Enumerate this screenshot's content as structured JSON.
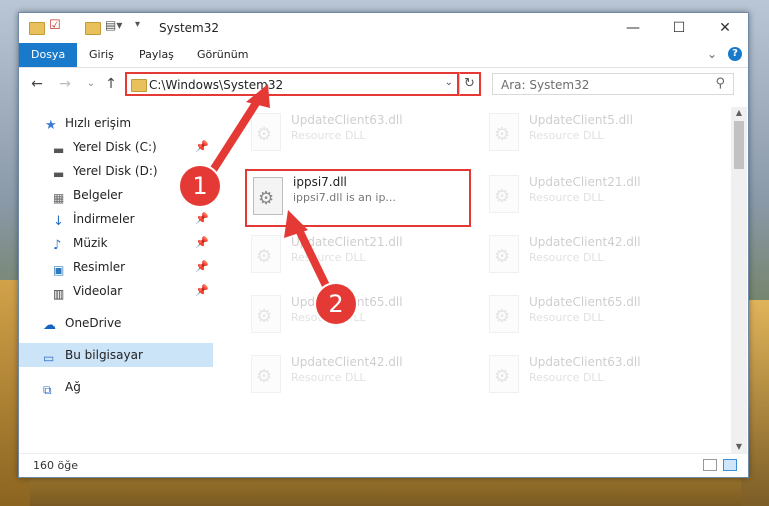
{
  "window": {
    "title": "System32",
    "minimize": "—",
    "maximize": "☐",
    "close": "✕"
  },
  "ribbon": {
    "tabs": [
      {
        "label": "Dosya",
        "active": true
      },
      {
        "label": "Giriş"
      },
      {
        "label": "Paylaş"
      },
      {
        "label": "Görünüm"
      }
    ],
    "collapse": "⌄",
    "help": "?"
  },
  "address": {
    "back": "←",
    "forward": "→",
    "recent": "⌄",
    "up": "↑",
    "path": "C:\\Windows\\System32",
    "dropdown": "⌄",
    "refresh": "↻",
    "search_placeholder": "Ara: System32",
    "search_icon": "⚲"
  },
  "sidebar": {
    "items": [
      {
        "label": "Hızlı erişim",
        "icon": "star-icon"
      },
      {
        "label": "Yerel Disk (C:)",
        "icon": "drive-icon",
        "pinned": true
      },
      {
        "label": "Yerel Disk (D:)",
        "icon": "drive-icon",
        "pinned": true
      },
      {
        "label": "Belgeler",
        "icon": "documents-icon",
        "pinned": true
      },
      {
        "label": "İndirmeler",
        "icon": "download-icon",
        "pinned": true
      },
      {
        "label": "Müzik",
        "icon": "music-icon",
        "pinned": true
      },
      {
        "label": "Resimler",
        "icon": "pictures-icon",
        "pinned": true
      },
      {
        "label": "Videolar",
        "icon": "video-icon",
        "pinned": true
      },
      {
        "label": "OneDrive",
        "icon": "cloud-icon"
      },
      {
        "label": "Bu bilgisayar",
        "icon": "computer-icon",
        "selected": true
      },
      {
        "label": "Ağ",
        "icon": "network-icon"
      }
    ]
  },
  "files": {
    "highlighted": {
      "name": "ippsi7.dll",
      "desc": "ippsi7.dll is an ip..."
    },
    "left_column": [
      {
        "name": "UpdateClient63.dll",
        "desc": "Resource DLL"
      },
      {
        "name": "UpdateClient21.dll",
        "desc": "Resource DLL"
      },
      {
        "name": "UpdateClient65.dll",
        "desc": "Resource DLL"
      },
      {
        "name": "UpdateClient42.dll",
        "desc": "Resource DLL"
      }
    ],
    "right_column": [
      {
        "name": "UpdateClient5.dll",
        "desc": "Resource DLL"
      },
      {
        "name": "UpdateClient21.dll",
        "desc": "Resource DLL"
      },
      {
        "name": "UpdateClient42.dll",
        "desc": "Resource DLL"
      },
      {
        "name": "UpdateClient65.dll",
        "desc": "Resource DLL"
      },
      {
        "name": "UpdateClient63.dll",
        "desc": "Resource DLL"
      }
    ]
  },
  "status": {
    "count": "160 öğe"
  },
  "annotations": {
    "step1": "1",
    "step2": "2",
    "color": "#e53935"
  },
  "colors": {
    "accent": "#1979ca",
    "selection": "#cce4f7",
    "highlight": "#e53935"
  }
}
